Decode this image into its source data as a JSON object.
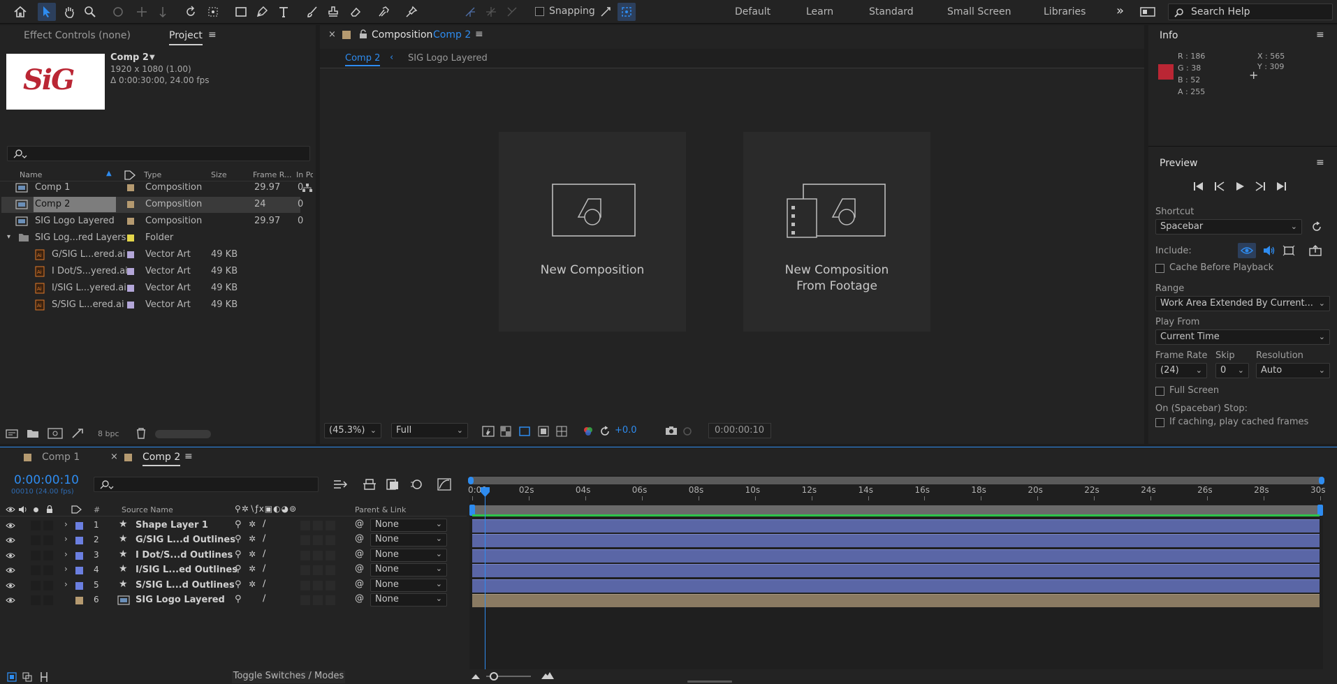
{
  "toolbar": {
    "snapping_label": "Snapping",
    "workspaces": [
      "Default",
      "Learn",
      "Standard",
      "Small Screen",
      "Libraries"
    ],
    "more_label": "»",
    "search_placeholder": "Search Help"
  },
  "left_panel": {
    "tabs": [
      "Effect Controls (none)",
      "Project"
    ],
    "comp_info": {
      "name": "Comp 2",
      "dims": "1920 x 1080 (1.00)",
      "duration": "Δ 0:00:30:00, 24.00 fps",
      "thumb_text": "SiG"
    },
    "columns": [
      "Name",
      "Type",
      "Size",
      "Frame R...",
      "In Po"
    ],
    "items": [
      {
        "name": "Comp 1",
        "type": "Composition",
        "size": "",
        "rate": "29.97",
        "inpoint": "0",
        "color": "#b59a70"
      },
      {
        "name": "Comp 2",
        "type": "Composition",
        "size": "",
        "rate": "24",
        "inpoint": "0",
        "color": "#b59a70"
      },
      {
        "name": "SIG Logo Layered",
        "type": "Composition",
        "size": "",
        "rate": "29.97",
        "inpoint": "0",
        "color": "#b59a70"
      },
      {
        "name": "SIG Log...red Layers",
        "type": "Folder",
        "size": "",
        "rate": "",
        "inpoint": "",
        "color": "#e3d54a"
      },
      {
        "name": "G/SIG L...ered.ai",
        "type": "Vector Art",
        "size": "49 KB",
        "rate": "",
        "inpoint": "",
        "color": "#b3a6d8"
      },
      {
        "name": "I Dot/S...yered.ai",
        "type": "Vector Art",
        "size": "49 KB",
        "rate": "",
        "inpoint": "",
        "color": "#b3a6d8"
      },
      {
        "name": "I/SIG L...yered.ai",
        "type": "Vector Art",
        "size": "49 KB",
        "rate": "",
        "inpoint": "",
        "color": "#b3a6d8"
      },
      {
        "name": "S/SIG L...ered.ai",
        "type": "Vector Art",
        "size": "49 KB",
        "rate": "",
        "inpoint": "",
        "color": "#b3a6d8"
      }
    ],
    "bpc_label": "8 bpc"
  },
  "comp_panel": {
    "title_prefix": "Composition",
    "title_comp": "Comp 2",
    "breadcrumb": [
      "Comp 2",
      "SIG Logo Layered"
    ],
    "card1_label": "New Composition",
    "card2_line1": "New Composition",
    "card2_line2": "From Footage",
    "zoom": "(45.3%)",
    "resolution": "Full",
    "exposure": "+0.0",
    "timecode": "0:00:00:10"
  },
  "info_panel": {
    "title": "Info",
    "r": "R : 186",
    "g": "G : 38",
    "b": "B : 52",
    "a": "A : 255",
    "x": "X : 565",
    "y": "Y : 309",
    "swatch": "#ba2634"
  },
  "preview_panel": {
    "title": "Preview",
    "shortcut_label": "Shortcut",
    "shortcut_value": "Spacebar",
    "include_label": "Include:",
    "cache_label": "Cache Before Playback",
    "range_label": "Range",
    "range_value": "Work Area Extended By Current...",
    "play_from_label": "Play From",
    "play_from_value": "Current Time",
    "frame_rate_label": "Frame Rate",
    "skip_label": "Skip",
    "resolution_label": "Resolution",
    "frame_rate_value": "(24)",
    "skip_value": "0",
    "resolution_value": "Auto",
    "full_screen_label": "Full Screen",
    "stop_label": "On (Spacebar) Stop:",
    "cached_label": "If caching, play cached frames"
  },
  "timeline": {
    "tabs": [
      "Comp 1",
      "Comp 2"
    ],
    "current_time": "0:00:00:10",
    "frames": "00010 (24.00 fps)",
    "col_hash": "#",
    "col_source": "Source Name",
    "col_parent": "Parent & Link",
    "ruler": [
      "0:00",
      "02s",
      "04s",
      "06s",
      "08s",
      "10s",
      "12s",
      "14s",
      "16s",
      "18s",
      "20s",
      "22s",
      "24s",
      "26s",
      "28s",
      "30s"
    ],
    "layers": [
      {
        "num": "1",
        "name": "Shape Layer 1",
        "parent": "None",
        "color": "#6b7fe0"
      },
      {
        "num": "2",
        "name": "G/SIG L...d Outlines",
        "parent": "None",
        "color": "#6b7fe0"
      },
      {
        "num": "3",
        "name": "I Dot/S...d Outlines",
        "parent": "None",
        "color": "#6b7fe0"
      },
      {
        "num": "4",
        "name": "I/SIG L...ed Outlines",
        "parent": "None",
        "color": "#6b7fe0"
      },
      {
        "num": "5",
        "name": "S/SIG L...d Outlines",
        "parent": "None",
        "color": "#6b7fe0"
      },
      {
        "num": "6",
        "name": "SIG Logo Layered",
        "parent": "None",
        "color": "#b59a70"
      }
    ],
    "toggle_label": "Toggle Switches / Modes"
  }
}
